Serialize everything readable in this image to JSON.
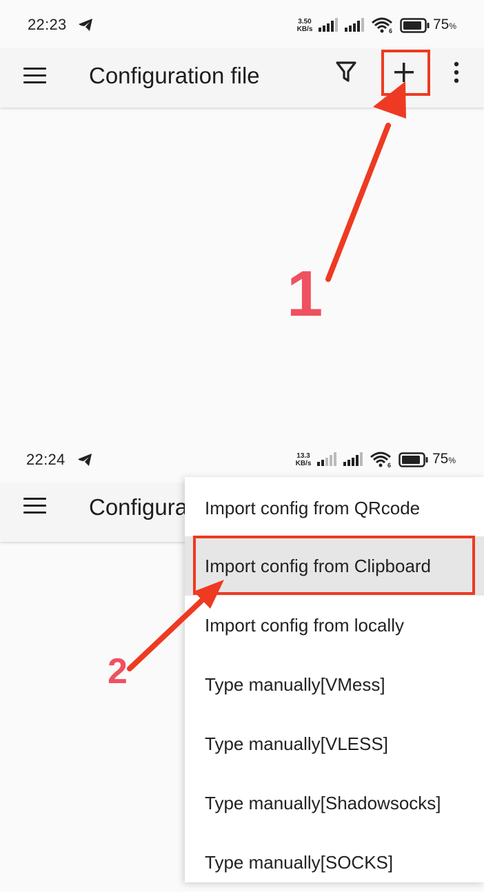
{
  "screen1": {
    "status": {
      "time": "22:23",
      "net_speed_value": "3.50",
      "net_speed_unit": "KB/s",
      "wifi_badge": "6",
      "battery_value": "75",
      "battery_unit": "%"
    },
    "appbar": {
      "title": "Configuration file"
    }
  },
  "screen2": {
    "status": {
      "time": "22:24",
      "net_speed_value": "13.3",
      "net_speed_unit": "KB/s",
      "wifi_badge": "6",
      "battery_value": "75",
      "battery_unit": "%"
    },
    "appbar": {
      "title": "Configuration file"
    },
    "menu": {
      "items": [
        {
          "label": "Import config from QRcode"
        },
        {
          "label": "Import config from Clipboard"
        },
        {
          "label": "Import config from locally"
        },
        {
          "label": "Type manually[VMess]"
        },
        {
          "label": "Type manually[VLESS]"
        },
        {
          "label": "Type manually[Shadowsocks]"
        },
        {
          "label": "Type manually[SOCKS]"
        }
      ],
      "selected_index": 1
    }
  },
  "annotations": {
    "step1": "1",
    "step2": "2"
  },
  "colors": {
    "annotation_red": "#ee3a22",
    "step_number": "#ef5160",
    "selected_row": "#e6e6e6"
  },
  "icons": [
    "telegram-icon",
    "signal-icon",
    "wifi-icon",
    "battery-icon",
    "menu-icon",
    "filter-icon",
    "plus-icon",
    "more-vertical-icon"
  ]
}
